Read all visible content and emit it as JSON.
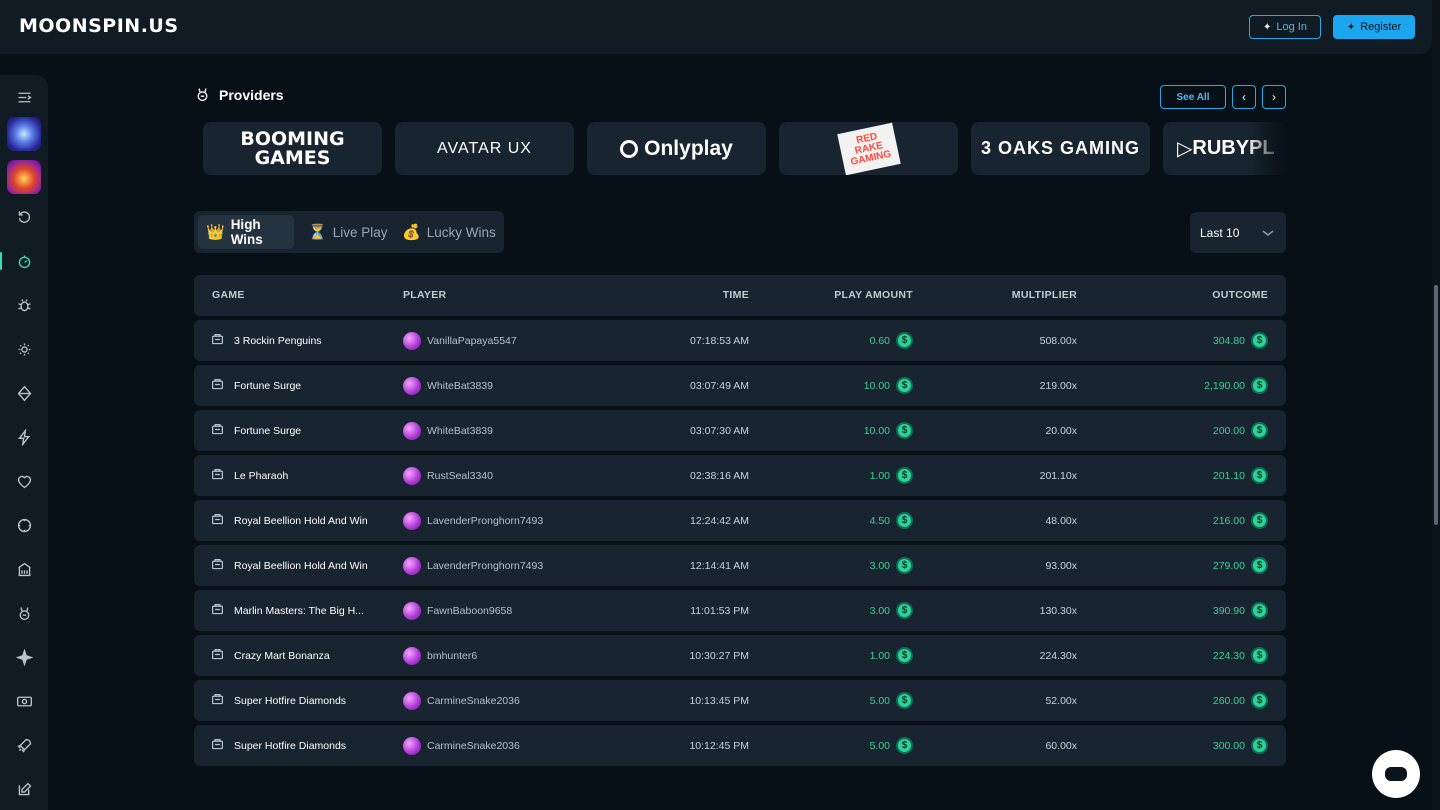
{
  "header": {
    "logo_text": "MOONSPIN.US",
    "login_label": "Log In",
    "register_label": "Register",
    "accent": "#1aa7ef"
  },
  "sidebar": {
    "items": [
      {
        "icon": "menu-collapse-icon"
      },
      {
        "icon": "promo-spiral-thumbnail"
      },
      {
        "icon": "promo-gift-thumbnail"
      },
      {
        "icon": "recent-icon"
      },
      {
        "icon": "lobby-icon",
        "active": true
      },
      {
        "icon": "bug-icon"
      },
      {
        "icon": "sun-icon"
      },
      {
        "icon": "diamond-icon"
      },
      {
        "icon": "bolt-icon"
      },
      {
        "icon": "heart-icon"
      },
      {
        "icon": "circle-icon"
      },
      {
        "icon": "casino-building-icon"
      },
      {
        "icon": "providers-icon"
      },
      {
        "icon": "sparkle-icon"
      },
      {
        "icon": "cash-icon"
      },
      {
        "icon": "rocket-icon"
      },
      {
        "icon": "edit-icon"
      }
    ]
  },
  "providers": {
    "title": "Providers",
    "see_all_label": "See All",
    "items": [
      {
        "name": "BOOMING GAMES"
      },
      {
        "name": "AVATAR UX"
      },
      {
        "name": "Onlyplay"
      },
      {
        "name": "RED RAKE GAMING"
      },
      {
        "name": "3 OAKS GAMING"
      },
      {
        "name": "RUBYPL"
      }
    ]
  },
  "tabs": [
    {
      "label": "High Wins",
      "icon": "crown-icon",
      "active": true
    },
    {
      "label": "Live Play",
      "icon": "hourglass-icon",
      "active": false
    },
    {
      "label": "Lucky Wins",
      "icon": "money-bag-icon",
      "active": false
    }
  ],
  "filter": {
    "selected": "Last 10"
  },
  "table": {
    "columns": {
      "game": "GAME",
      "player": "PLAYER",
      "time": "TIME",
      "amount": "PLAY AMOUNT",
      "multiplier": "MULTIPLIER",
      "outcome": "OUTCOME"
    },
    "coin_symbol": "$",
    "rows": [
      {
        "game": "3 Rockin Penguins",
        "player": "VanillaPapaya5547",
        "time": "07:18:53 AM",
        "amount": "0.60",
        "multiplier": "508.00x",
        "outcome": "304.80"
      },
      {
        "game": "Fortune Surge",
        "player": "WhiteBat3839",
        "time": "03:07:49 AM",
        "amount": "10.00",
        "multiplier": "219.00x",
        "outcome": "2,190.00"
      },
      {
        "game": "Fortune Surge",
        "player": "WhiteBat3839",
        "time": "03:07:30 AM",
        "amount": "10.00",
        "multiplier": "20.00x",
        "outcome": "200.00"
      },
      {
        "game": "Le Pharaoh",
        "player": "RustSeal3340",
        "time": "02:38:16 AM",
        "amount": "1.00",
        "multiplier": "201.10x",
        "outcome": "201.10"
      },
      {
        "game": "Royal Beellion Hold And Win",
        "player": "LavenderPronghorn7493",
        "time": "12:24:42 AM",
        "amount": "4.50",
        "multiplier": "48.00x",
        "outcome": "216.00"
      },
      {
        "game": "Royal Beellion Hold And Win",
        "player": "LavenderPronghorn7493",
        "time": "12:14:41 AM",
        "amount": "3.00",
        "multiplier": "93.00x",
        "outcome": "279.00"
      },
      {
        "game": "Marlin Masters: The Big H...",
        "player": "FawnBaboon9658",
        "time": "11:01:53 PM",
        "amount": "3.00",
        "multiplier": "130.30x",
        "outcome": "390.90"
      },
      {
        "game": "Crazy Mart Bonanza",
        "player": "bmhunter6",
        "time": "10:30:27 PM",
        "amount": "1.00",
        "multiplier": "224.30x",
        "outcome": "224.30"
      },
      {
        "game": "Super Hotfire Diamonds",
        "player": "CarmineSnake2036",
        "time": "10:13:45 PM",
        "amount": "5.00",
        "multiplier": "52.00x",
        "outcome": "260.00"
      },
      {
        "game": "Super Hotfire Diamonds",
        "player": "CarmineSnake2036",
        "time": "10:12:45 PM",
        "amount": "5.00",
        "multiplier": "60.00x",
        "outcome": "300.00"
      }
    ]
  },
  "colors": {
    "background": "#081017",
    "panel": "#182530",
    "win_green": "#3ccf9e",
    "active_green": "#33e0b6"
  }
}
